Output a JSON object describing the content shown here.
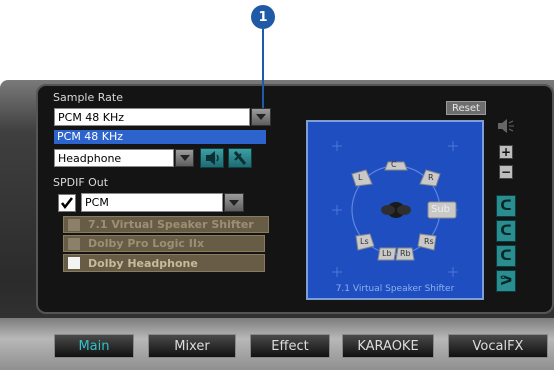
{
  "callout": {
    "number": "1"
  },
  "sample_rate": {
    "label": "Sample Rate",
    "value": "PCM 48 KHz",
    "dropdown_items": [
      "PCM 48 KHz"
    ]
  },
  "output": {
    "value": "Headphone"
  },
  "spdif": {
    "label": "SPDIF Out",
    "checked": true,
    "value": "PCM"
  },
  "options": [
    {
      "label": "7.1 Virtual Speaker Shifter",
      "checked": false
    },
    {
      "label": "Dolby Pro Logic IIx",
      "checked": false
    },
    {
      "label": "Dolby Headphone",
      "checked": false
    }
  ],
  "speaker_panel": {
    "reset_label": "Reset",
    "caption": "7.1 Virtual Speaker Shifter",
    "speakers": [
      "L",
      "C",
      "R",
      "Sub",
      "Ls",
      "Rs",
      "Lb",
      "Rb"
    ]
  },
  "side_controls": {
    "plus": "+",
    "minus": "−"
  },
  "tabs": [
    "Main",
    "Mixer",
    "Effect",
    "KARAOKE",
    "VocalFX"
  ],
  "active_tab": "Main"
}
